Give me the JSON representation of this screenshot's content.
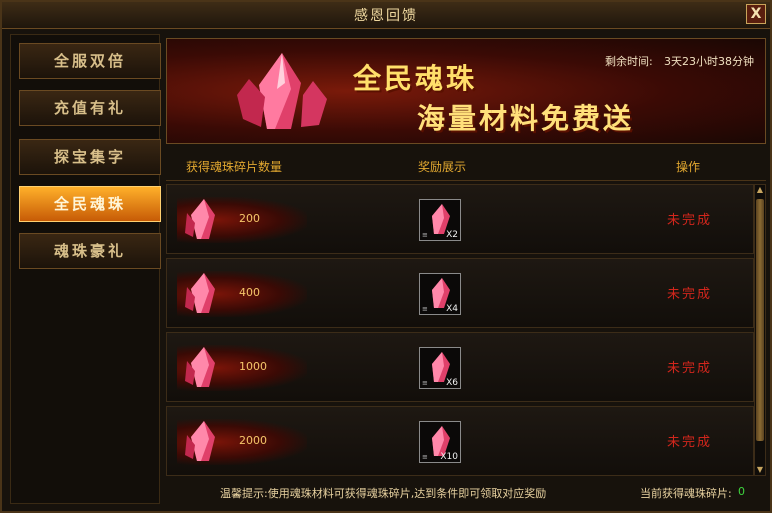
{
  "window": {
    "title": "感恩回馈",
    "close_label": "X"
  },
  "sidebar": {
    "items": [
      {
        "label": "全服双倍",
        "active": false
      },
      {
        "label": "充值有礼",
        "active": false
      },
      {
        "label": "探宝集字",
        "active": false
      },
      {
        "label": "全民魂珠",
        "active": true
      },
      {
        "label": "魂珠豪礼",
        "active": false
      }
    ]
  },
  "banner": {
    "title": "全民魂珠",
    "subtitle": "海量材料免费送",
    "timer_label": "剩余时间:",
    "timer_value": "3天23小时38分钟"
  },
  "table": {
    "headers": {
      "count": "获得魂珠碎片数量",
      "reward": "奖励展示",
      "action": "操作"
    },
    "rows": [
      {
        "count": "200",
        "reward_qty": "X2",
        "status": "未完成"
      },
      {
        "count": "400",
        "reward_qty": "X4",
        "status": "未完成"
      },
      {
        "count": "1000",
        "reward_qty": "X6",
        "status": "未完成"
      },
      {
        "count": "2000",
        "reward_qty": "X10",
        "status": "未完成"
      }
    ]
  },
  "footer": {
    "tip": "温馨提示:使用魂珠材料可获得魂珠碎片,达到条件即可领取对应奖励",
    "count_label": "当前获得魂珠碎片:",
    "count_value": "0"
  },
  "colors": {
    "accent": "#e2a830",
    "status_incomplete": "#d2261c",
    "count_highlight": "#3ed43e"
  }
}
